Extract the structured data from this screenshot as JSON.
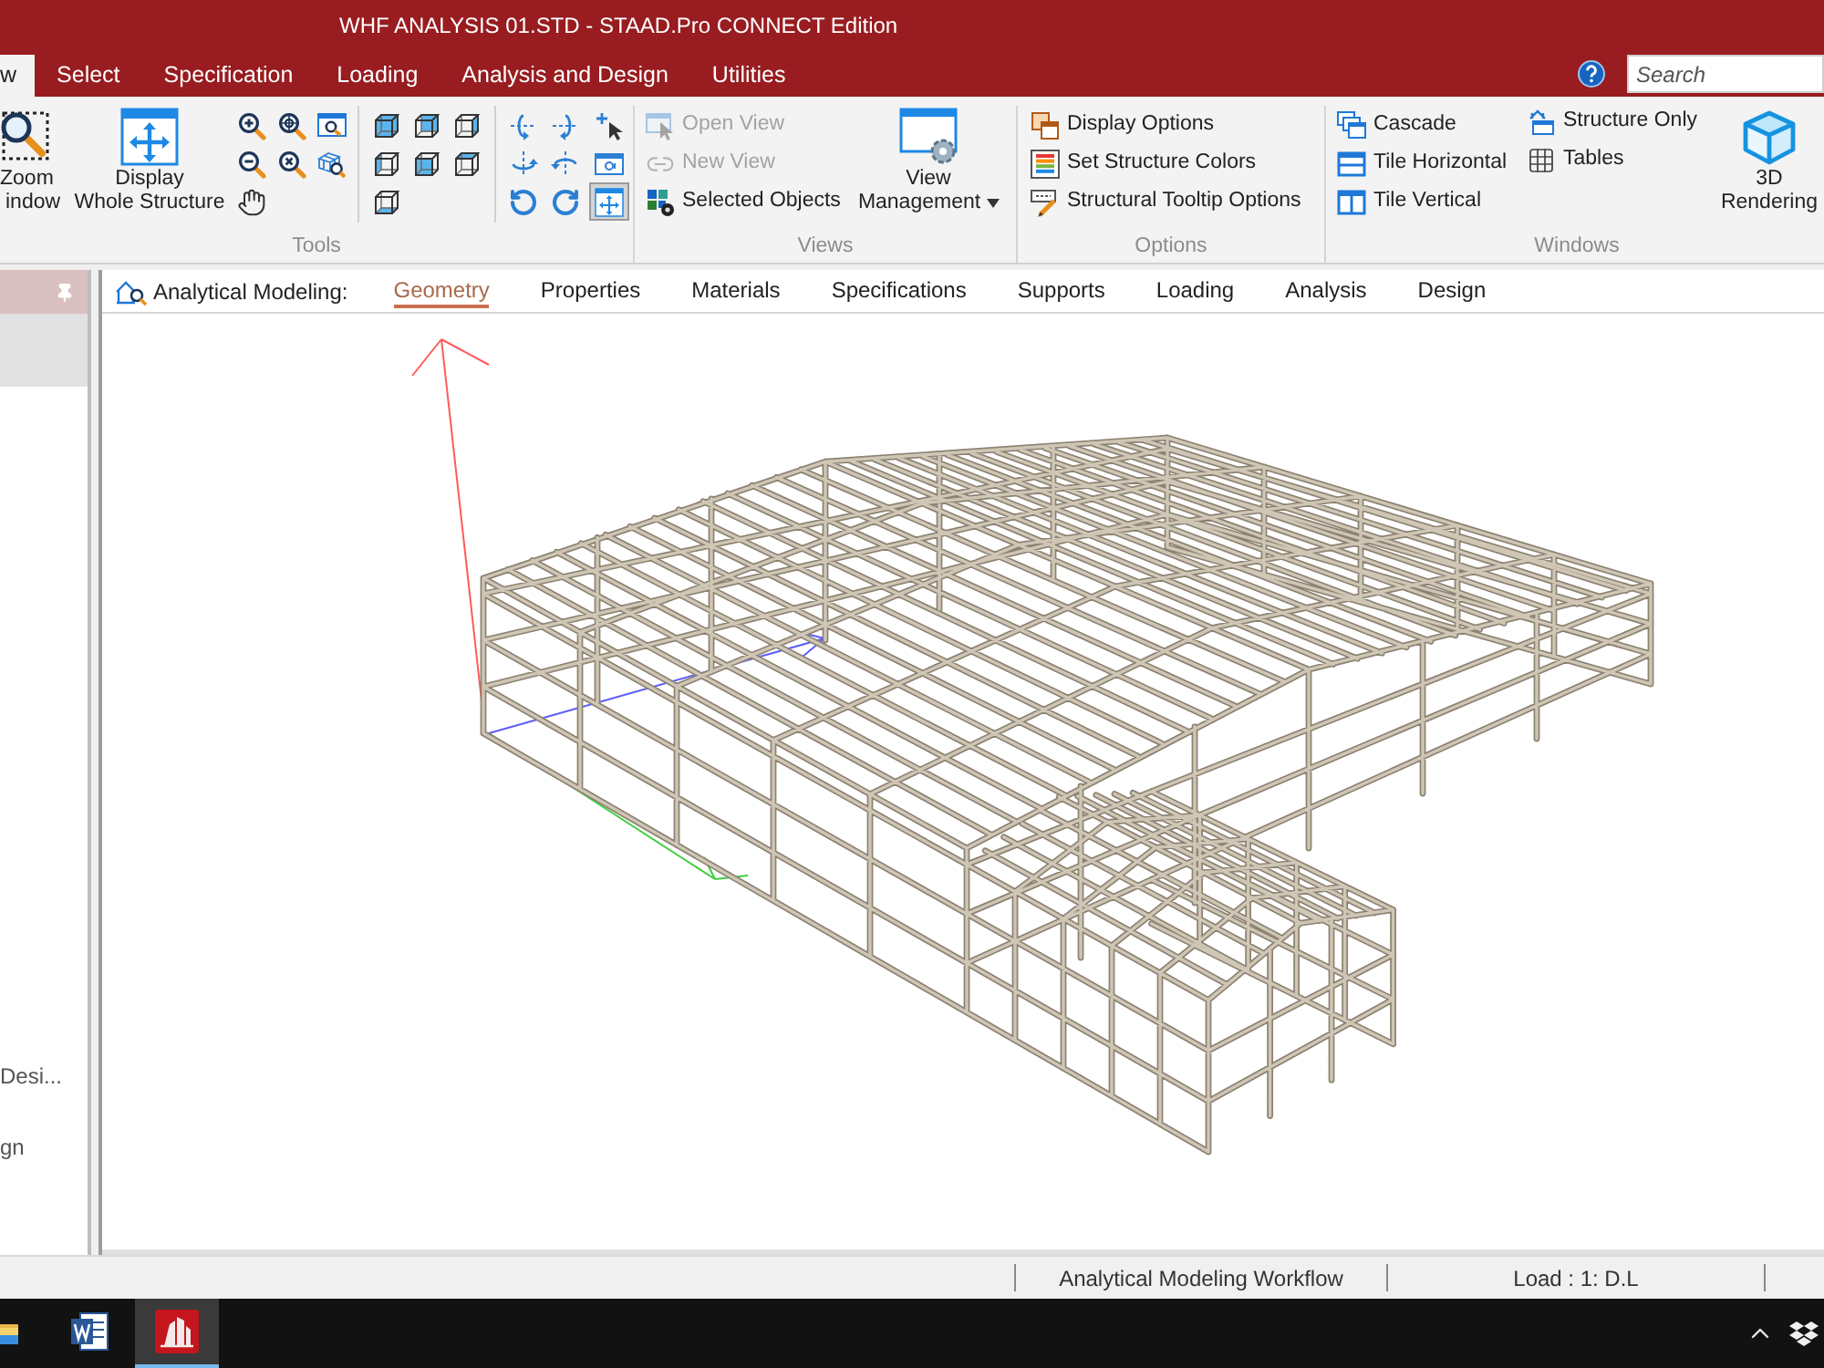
{
  "window": {
    "title": "WHF ANALYSIS 01.STD - STAAD.Pro CONNECT Edition"
  },
  "menu_tabs": [
    {
      "label": "w",
      "selected": true
    },
    {
      "label": "Select",
      "selected": false
    },
    {
      "label": "Specification",
      "selected": false
    },
    {
      "label": "Loading",
      "selected": false
    },
    {
      "label": "Analysis and Design",
      "selected": false
    },
    {
      "label": "Utilities",
      "selected": false
    }
  ],
  "search": {
    "placeholder": "Search"
  },
  "ribbon": {
    "tools": {
      "label": "Tools",
      "zoom_window": [
        "Zoom",
        "indow"
      ],
      "display_whole_structure": [
        "Display",
        "Whole Structure"
      ],
      "orbit_tools": [
        {
          "on": false
        },
        {
          "on": false
        },
        {
          "on": false
        },
        {
          "on": false
        },
        {
          "on": false
        },
        {
          "on": false
        },
        {
          "on": false
        },
        {
          "on": false
        },
        {
          "on": true
        }
      ]
    },
    "views": {
      "label": "Views",
      "items": [
        {
          "label": "Open View",
          "disabled": true
        },
        {
          "label": "New View",
          "disabled": true
        },
        {
          "label": "Selected Objects",
          "disabled": false
        }
      ],
      "view_management": [
        "View",
        "Management"
      ]
    },
    "options": {
      "label": "Options",
      "items": [
        "Display Options",
        "Set Structure Colors",
        "Structural Tooltip Options"
      ]
    },
    "windows": {
      "label": "Windows",
      "items": [
        "Cascade",
        "Tile Horizontal",
        "Tile Vertical",
        "Structure Only",
        "Tables"
      ],
      "rendering": [
        "3D",
        "Rendering"
      ]
    }
  },
  "left_panel": {
    "items": [
      {
        "selected": true
      },
      {
        "label": "Desi...",
        "selected": false
      },
      {
        "label": "gn",
        "selected": false
      }
    ]
  },
  "workflow": {
    "title": "Analytical Modeling:",
    "tabs": [
      {
        "label": "Geometry",
        "selected": true
      },
      {
        "label": "Properties",
        "selected": false
      },
      {
        "label": "Materials",
        "selected": false
      },
      {
        "label": "Specifications",
        "selected": false
      },
      {
        "label": "Supports",
        "selected": false
      },
      {
        "label": "Loading",
        "selected": false
      },
      {
        "label": "Analysis",
        "selected": false
      },
      {
        "label": "Design",
        "selected": false
      }
    ]
  },
  "status_bar": {
    "fields": [
      "Analytical Modeling Workflow",
      "Load : 1: D.L"
    ]
  },
  "taskbar": {
    "apps": [
      {
        "kind": "folder",
        "selected": false
      },
      {
        "kind": "document",
        "selected": false
      },
      {
        "kind": "building",
        "selected": true
      }
    ]
  }
}
